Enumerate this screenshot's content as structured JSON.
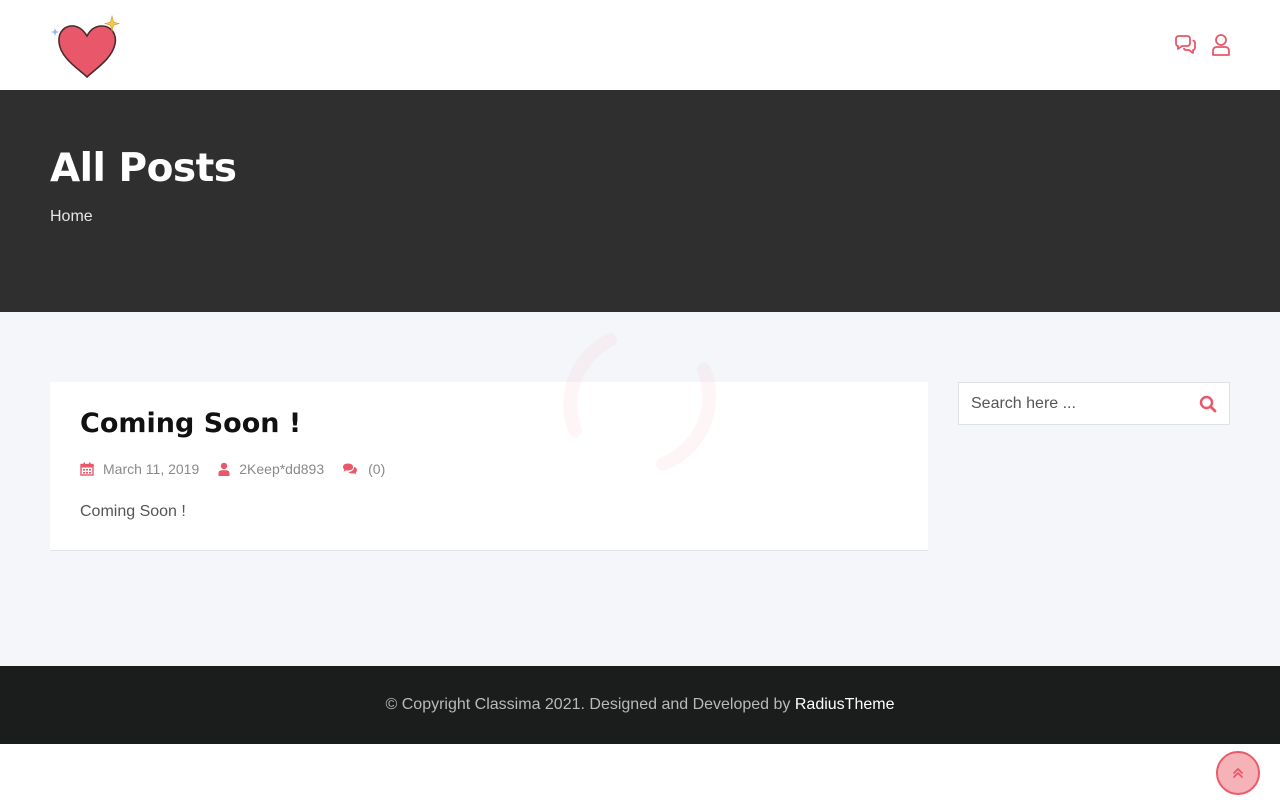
{
  "colors": {
    "accent": "#e8586a",
    "banner_bg": "#2f2f2f",
    "content_bg": "#f5f6fa",
    "footer_bg": "#1b1c1c"
  },
  "header": {
    "logo_icon": "heart-logo-icon",
    "icons": [
      "chat-icon",
      "user-icon"
    ]
  },
  "banner": {
    "title": "All Posts",
    "breadcrumb": "Home"
  },
  "post": {
    "title": "Coming Soon !",
    "date": "March 11, 2019",
    "author": "2Keep*dd893",
    "comments": "(0)",
    "excerpt": "Coming Soon !"
  },
  "sidebar": {
    "search_placeholder": "Search here ..."
  },
  "footer": {
    "copyright": "© Copyright Classima 2021. Designed and Developed by",
    "developer_link": "RadiusTheme"
  }
}
